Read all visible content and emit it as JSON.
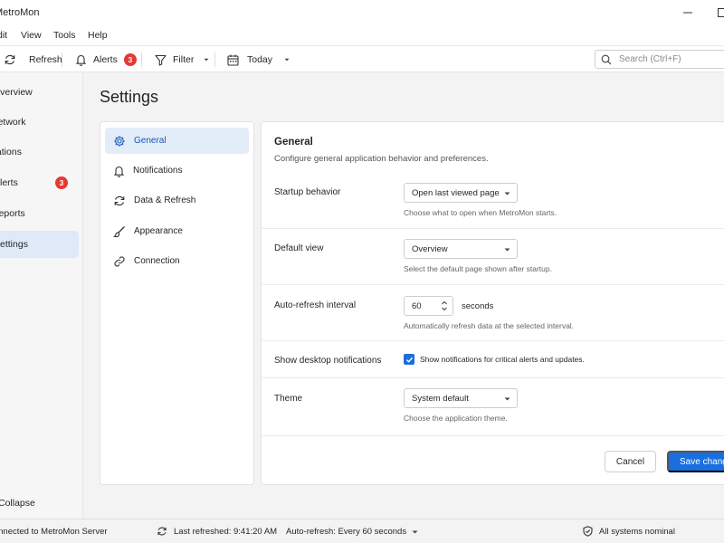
{
  "app": {
    "title": "MetroMon"
  },
  "menu": [
    "Edit",
    "View",
    "Tools",
    "Help"
  ],
  "toolbar": {
    "refresh": "Refresh",
    "alerts": "Alerts",
    "alerts_count": "3",
    "filter": "Filter",
    "today": "Today",
    "search_placeholder": "Search (Ctrl+F)"
  },
  "nav": {
    "items": [
      {
        "label": "Overview",
        "icon": "overview-icon"
      },
      {
        "label": "Network",
        "icon": "network-icon"
      },
      {
        "label": "Stations",
        "icon": "stations-icon"
      },
      {
        "label": "Alerts",
        "icon": "alerts-icon",
        "badge": "3"
      },
      {
        "label": "Reports",
        "icon": "reports-icon"
      },
      {
        "label": "Settings",
        "icon": "settings-icon",
        "active": true
      }
    ],
    "collapse": "Collapse"
  },
  "page": {
    "title": "Settings"
  },
  "subnav": [
    {
      "label": "General",
      "icon": "gear-icon",
      "active": true
    },
    {
      "label": "Notifications",
      "icon": "bell-icon"
    },
    {
      "label": "Data & Refresh",
      "icon": "refresh-icon"
    },
    {
      "label": "Appearance",
      "icon": "brush-icon"
    },
    {
      "label": "Connection",
      "icon": "link-icon"
    }
  ],
  "general": {
    "title": "General",
    "description": "Configure general application behavior and preferences.",
    "startup": {
      "label": "Startup behavior",
      "value": "Open last viewed page",
      "help": "Choose what to open when MetroMon starts."
    },
    "default_view": {
      "label": "Default view",
      "value": "Overview",
      "help": "Select the default page shown after startup."
    },
    "auto_refresh": {
      "label": "Auto-refresh interval",
      "value": "60",
      "unit": "seconds",
      "help": "Automatically refresh data at the selected interval."
    },
    "notifications": {
      "label": "Show desktop notifications",
      "checked": true,
      "check_label": "Show notifications for critical alerts and updates."
    },
    "theme": {
      "label": "Theme",
      "value": "System default",
      "help": "Choose the application theme."
    },
    "cancel": "Cancel",
    "save": "Save changes"
  },
  "status": {
    "connection": "Connected to MetroMon Server",
    "last_refreshed": "Last refreshed: 9:41:20 AM",
    "auto_refresh": "Auto-refresh: Every 60 seconds",
    "health": "All systems nominal"
  },
  "colors": {
    "accent": "#1a6fe0",
    "badge": "#e53935",
    "active_bg": "#dfe9f7"
  }
}
